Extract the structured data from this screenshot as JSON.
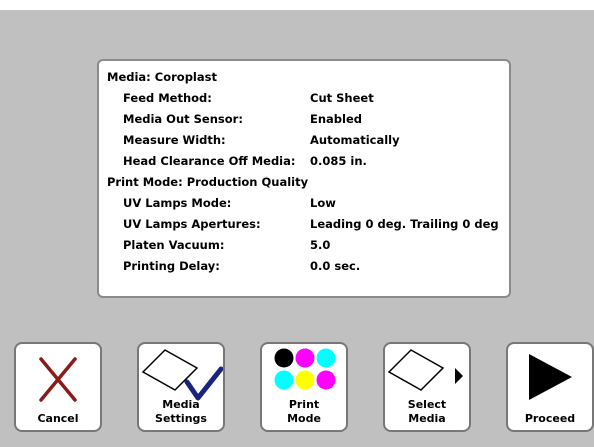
{
  "media": {
    "heading": "Media: Coroplast",
    "rows": [
      {
        "label": "Feed Method:",
        "value": "Cut Sheet"
      },
      {
        "label": "Media Out Sensor:",
        "value": "Enabled"
      },
      {
        "label": "Measure Width:",
        "value": "Automatically"
      },
      {
        "label": "Head Clearance Off Media:",
        "value": "0.085 in."
      }
    ]
  },
  "print_mode": {
    "heading": "Print Mode: Production Quality",
    "rows": [
      {
        "label": "UV Lamps Mode:",
        "value": "Low"
      },
      {
        "label": "UV Lamps Apertures:",
        "value": "Leading 0 deg. Trailing 0 deg"
      },
      {
        "label": "Platen Vacuum:",
        "value": "5.0"
      },
      {
        "label": "Printing Delay:",
        "value": "0.0 sec."
      }
    ]
  },
  "buttons": {
    "cancel": {
      "label": "Cancel",
      "icon": "x-icon"
    },
    "media_settings": {
      "line1": "Media",
      "line2": "Settings",
      "icon": "media-check-icon"
    },
    "print_mode": {
      "line1": "Print",
      "line2": "Mode",
      "icon": "cmyk-dots-icon"
    },
    "select_media": {
      "line1": "Select",
      "line2": "Media",
      "icon": "media-arrow-icon"
    },
    "proceed": {
      "label": "Proceed",
      "icon": "play-icon"
    }
  },
  "colors": {
    "cancel_x": "#8b1a1a",
    "check": "#1a237e",
    "black": "#000000",
    "magenta": "#ff00ff",
    "cyan": "#00ffff",
    "yellow": "#ffff00"
  }
}
